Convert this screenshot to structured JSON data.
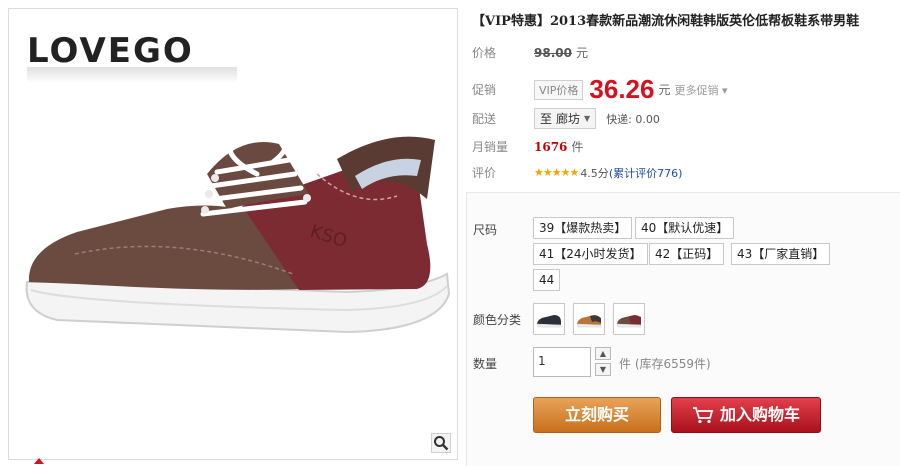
{
  "gallery": {
    "brand": "LOVEGO"
  },
  "product": {
    "title": "【VIP特惠】2013春款新品潮流休闲鞋韩版英伦低帮板鞋系带男鞋"
  },
  "price": {
    "label": "价格",
    "original": "98.00",
    "unit": "元"
  },
  "promo": {
    "label": "促销",
    "tag": "VIP价格",
    "price": "36.26",
    "unit": "元",
    "more": "更多促销"
  },
  "shipping": {
    "label": "配送",
    "to": "至",
    "destination": "廊坊",
    "express": "快递: 0.00"
  },
  "sales": {
    "label": "月销量",
    "count": "1676",
    "unit": "件"
  },
  "rating": {
    "label": "评价",
    "stars": "★★★★★",
    "score": "4.5分",
    "reviews": "(累计评价776)",
    "accent": "#f0a800"
  },
  "options": {
    "size_label": "尺码",
    "sizes": [
      "39【爆款热卖】",
      "40【默认优速】",
      "41【24小时发货】",
      "42【正码】",
      "43【厂家直销】",
      "44"
    ],
    "color_label": "颜色分类",
    "quantity_label": "数量",
    "quantity": "1",
    "stock": "件 (库存6559件)"
  },
  "actions": {
    "buy_now": "立刻购买",
    "add_to_cart": "加入购物车",
    "buy_color": "#c8701c",
    "cart_color": "#a9111c"
  },
  "colors": {
    "price_red": "#d5111e"
  }
}
